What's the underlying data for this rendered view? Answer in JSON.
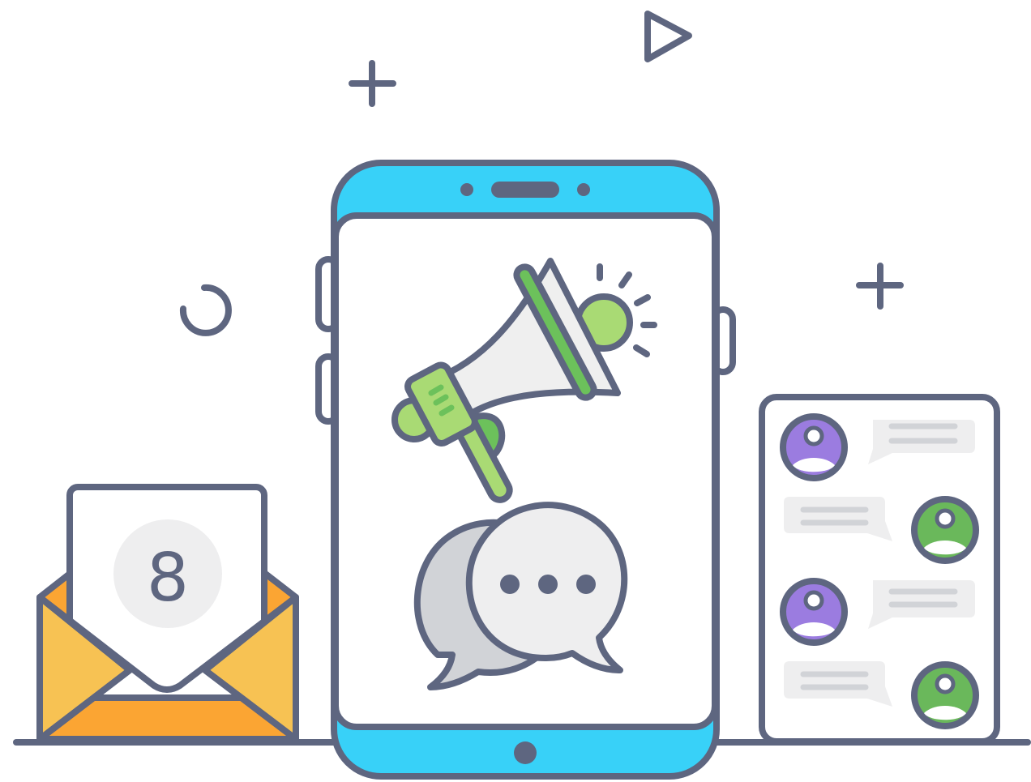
{
  "illustration": {
    "theme": "mobile-marketing-notifications",
    "colors": {
      "outline": "#5e6680",
      "phone_frame": "#38d1f8",
      "screen": "#ffffff",
      "megaphone_body": "#efefef",
      "megaphone_accent": "#6cc15b",
      "megaphone_light": "#a9da74",
      "chat_gray": "#d1d3d7",
      "chat_light": "#eeeeef",
      "envelope_front": "#f7c253",
      "envelope_back": "#fba533",
      "avatar_purple": "#9b7ce0",
      "avatar_green": "#6ab85b"
    },
    "envelope": {
      "badge_count": "8"
    },
    "chat_panel": {
      "message_count": 4
    }
  }
}
